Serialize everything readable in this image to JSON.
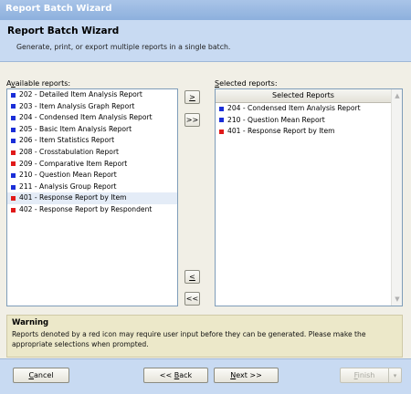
{
  "window": {
    "title": "Report Batch Wizard"
  },
  "header": {
    "title": "Report Batch Wizard",
    "subtitle": "Generate, print, or export multiple reports in a single batch."
  },
  "colors": {
    "blue": "#1a2ed8",
    "red": "#e01919"
  },
  "available": {
    "label_prefix": "A",
    "label_underlined": "v",
    "label_rest": "ailable reports:",
    "items": [
      {
        "text": "202 - Detailed Item Analysis Report",
        "icon": "blue"
      },
      {
        "text": "203 - Item Analysis Graph Report",
        "icon": "blue"
      },
      {
        "text": "204 - Condensed Item Analysis Report",
        "icon": "blue"
      },
      {
        "text": "205 - Basic Item Analysis Report",
        "icon": "blue"
      },
      {
        "text": "206 - Item Statistics Report",
        "icon": "blue"
      },
      {
        "text": "208 - Crosstabulation Report",
        "icon": "red"
      },
      {
        "text": "209 - Comparative Item Report",
        "icon": "red"
      },
      {
        "text": "210 - Question Mean Report",
        "icon": "blue"
      },
      {
        "text": "211 - Analysis Group Report",
        "icon": "blue"
      },
      {
        "text": "401 - Response Report by Item",
        "icon": "red"
      },
      {
        "text": "402 - Response Report by Respondent",
        "icon": "red"
      }
    ]
  },
  "selected": {
    "label_underlined": "S",
    "label_rest": "elected reports:",
    "column_header": "Selected Reports",
    "items": [
      {
        "text": "204 - Condensed Item Analysis Report",
        "icon": "blue"
      },
      {
        "text": "210 - Question Mean Report",
        "icon": "blue"
      },
      {
        "text": "401 - Response Report by Item",
        "icon": "red"
      }
    ]
  },
  "transfer": {
    "add": ">",
    "add_all": ">>",
    "remove": "<",
    "remove_all": "<<"
  },
  "warning": {
    "title": "Warning",
    "text": "Reports denoted by a red icon may require user input before they can be generated. Please make the appropriate selections when prompted."
  },
  "footer": {
    "cancel_u": "C",
    "cancel_rest": "ancel",
    "back_pre": "<< ",
    "back_u": "B",
    "back_rest": "ack",
    "next_u": "N",
    "next_rest": "ext >>",
    "finish_u": "F",
    "finish_rest": "inish",
    "dropdown_icon": "chevron-down-icon"
  }
}
